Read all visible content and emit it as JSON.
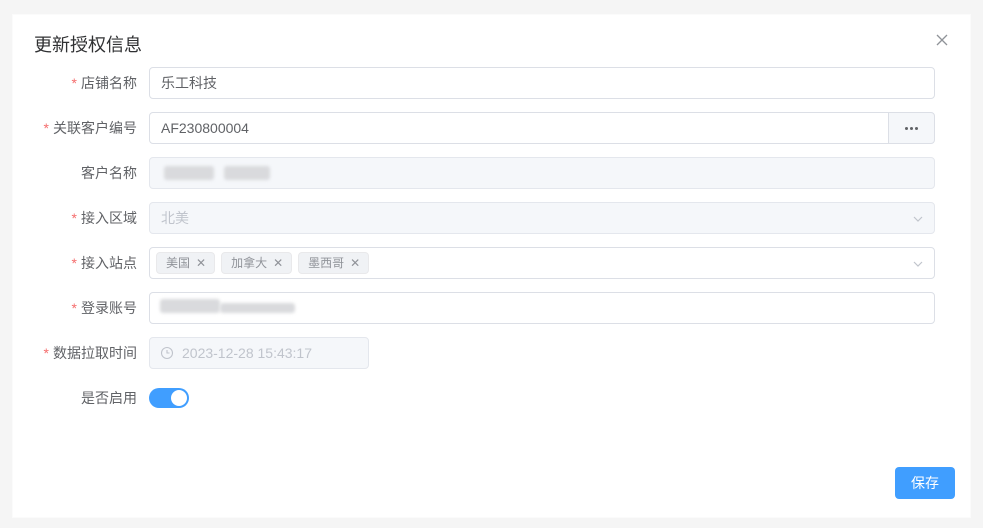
{
  "dialog": {
    "title": "更新授权信息",
    "close_icon": "close-icon"
  },
  "form": {
    "store_name": {
      "label": "店铺名称",
      "required": "*",
      "value": "乐工科技"
    },
    "customer_no": {
      "label": "关联客户编号",
      "required": "*",
      "value": "AF230800004",
      "button_icon": "more-dots-icon"
    },
    "customer_name": {
      "label": "客户名称",
      "value_redacted": true
    },
    "region": {
      "label": "接入区域",
      "required": "*",
      "value": "北美"
    },
    "sites": {
      "label": "接入站点",
      "required": "*",
      "tags": [
        "美国",
        "加拿大",
        "墨西哥"
      ]
    },
    "account": {
      "label": "登录账号",
      "required": "*",
      "value_redacted": true
    },
    "pull_time": {
      "label": "数据拉取时间",
      "required": "*",
      "value": "2023-12-28 15:43:17"
    },
    "enabled": {
      "label": "是否启用",
      "value": true
    }
  },
  "footer": {
    "save_label": "保存"
  },
  "colors": {
    "primary": "#409eff",
    "required": "#f56c6c"
  }
}
